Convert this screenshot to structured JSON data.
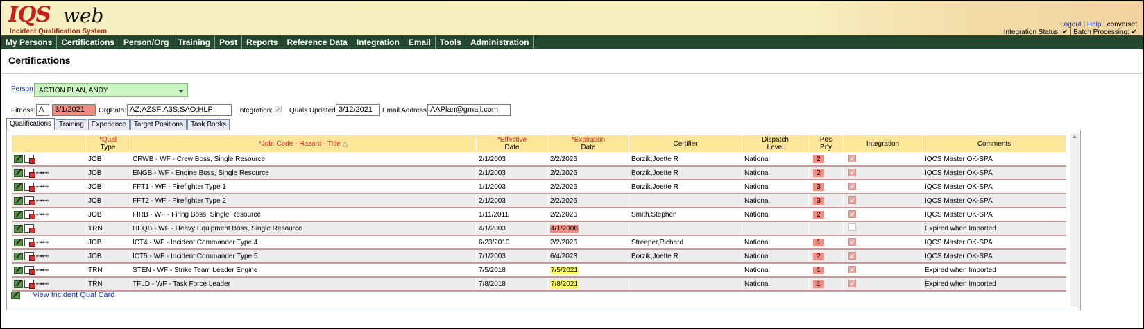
{
  "header": {
    "logo_main": "IQS",
    "logo_web": "web",
    "logo_subtitle": "Incident Qualification System",
    "links": {
      "logout": "Logout",
      "help": "Help",
      "user": "converset"
    },
    "status_text": "Integration Status: ✔ | Batch Processing: ✔"
  },
  "nav": [
    "My Persons",
    "Certifications",
    "Person/Org",
    "Training",
    "Post",
    "Reports",
    "Reference Data",
    "Integration",
    "Email",
    "Tools",
    "Administration"
  ],
  "page_title": "Certifications",
  "person": {
    "label": "Person",
    "value": "ACTION PLAN, ANDY"
  },
  "info": {
    "fitness_label": "Fitness:",
    "fitness_value": "A",
    "fitness_date": "3/1/2021",
    "orgpath_label": "OrgPath:",
    "orgpath_value": "AZ;AZSF;A3S;SAO;HLP;;",
    "integration_label": "Integration:",
    "quals_updated_label": "Quals Updated:",
    "quals_updated_value": "3/12/2021",
    "email_label": "Email Address:",
    "email_value": "AAPlan@gmail.com"
  },
  "tabs": [
    "Qualifications",
    "Training",
    "Experience",
    "Target Positions",
    "Task Books"
  ],
  "table": {
    "headers": {
      "qual_type_1": "*Qual",
      "qual_type_2": "Type",
      "job": "*Job: Code - Hazard - Title",
      "effective_1": "*Effective",
      "effective_2": "Date",
      "expiration_1": "*Expiration",
      "expiration_2": "Date",
      "certifier": "Certifier",
      "dispatch_1": "Dispatch",
      "dispatch_2": "Level",
      "pos_1": "Pos",
      "pos_2": "Pr'y",
      "integration": "Integration",
      "comments": "Comments"
    },
    "rows": [
      {
        "type": "JOB",
        "job": "CRWB - WF - Crew Boss, Single Resource",
        "effective": "2/1/2003",
        "expiration": "2/2/2026",
        "exp_style": "",
        "certifier": "Borzik,Joette R",
        "dispatch": "National",
        "pos": "2",
        "integ": true,
        "comments": "IQCS Master OK-SPA",
        "glasses": false
      },
      {
        "type": "JOB",
        "job": "ENGB - WF - Engine Boss, Single Resource",
        "effective": "2/1/2003",
        "expiration": "2/2/2026",
        "exp_style": "",
        "certifier": "Borzik,Joette R",
        "dispatch": "National",
        "pos": "2",
        "integ": true,
        "comments": "IQCS Master OK-SPA",
        "glasses": true
      },
      {
        "type": "JOB",
        "job": "FFT1 - WF - Firefighter Type 1",
        "effective": "1/1/2003",
        "expiration": "2/2/2026",
        "exp_style": "",
        "certifier": "Borzik,Joette R",
        "dispatch": "National",
        "pos": "3",
        "integ": true,
        "comments": "IQCS Master OK-SPA",
        "glasses": true
      },
      {
        "type": "JOB",
        "job": "FFT2 - WF - Firefighter Type 2",
        "effective": "2/1/2003",
        "expiration": "2/2/2026",
        "exp_style": "",
        "certifier": "",
        "dispatch": "National",
        "pos": "3",
        "integ": true,
        "comments": "IQCS Master OK-SPA",
        "glasses": true
      },
      {
        "type": "JOB",
        "job": "FIRB - WF - Firing Boss, Single Resource",
        "effective": "1/11/2011",
        "expiration": "2/2/2026",
        "exp_style": "",
        "certifier": "Smith,Stephen",
        "dispatch": "National",
        "pos": "2",
        "integ": true,
        "comments": "IQCS Master OK-SPA",
        "glasses": true
      },
      {
        "type": "TRN",
        "job": "HEQB - WF - Heavy Equipment Boss, Single Resource",
        "effective": "4/1/2003",
        "expiration": "4/1/2006",
        "exp_style": "red",
        "certifier": "",
        "dispatch": "",
        "pos": "",
        "integ": false,
        "comments": "Expired when Imported",
        "glasses": false
      },
      {
        "type": "JOB",
        "job": "ICT4 - WF - Incident Commander Type 4",
        "effective": "6/23/2010",
        "expiration": "2/2/2026",
        "exp_style": "",
        "certifier": "Streeper,Richard",
        "dispatch": "National",
        "pos": "1",
        "integ": true,
        "comments": "IQCS Master OK-SPA",
        "glasses": true
      },
      {
        "type": "JOB",
        "job": "ICT5 - WF - Incident Commander Type 5",
        "effective": "7/1/2003",
        "expiration": "6/4/2023",
        "exp_style": "",
        "certifier": "Borzik,Joette R",
        "dispatch": "National",
        "pos": "2",
        "integ": true,
        "comments": "IQCS Master OK-SPA",
        "glasses": true
      },
      {
        "type": "TRN",
        "job": "STEN - WF - Strike Team Leader Engine",
        "effective": "7/5/2018",
        "expiration": "7/5/2021",
        "exp_style": "yellow",
        "certifier": "",
        "dispatch": "National",
        "pos": "1",
        "integ": true,
        "comments": "Expired when Imported",
        "glasses": true
      },
      {
        "type": "TRN",
        "job": "TFLD - WF - Task Force Leader",
        "effective": "7/8/2018",
        "expiration": "7/8/2021",
        "exp_style": "yellow",
        "certifier": "",
        "dispatch": "National",
        "pos": "1",
        "integ": true,
        "comments": "Expired when Imported",
        "glasses": true
      }
    ]
  },
  "qual_card_link": "View Incident Qual Card",
  "icons": {
    "edit": "edit-icon",
    "certificate": "certificate-icon",
    "glasses": "glasses-icon",
    "check": "✔"
  },
  "colors": {
    "nav": "#23482f",
    "header_row": "#fce699",
    "alert_red": "#f08c82",
    "alert_yellow": "#ffff66",
    "person_select": "#ccf5c3"
  }
}
